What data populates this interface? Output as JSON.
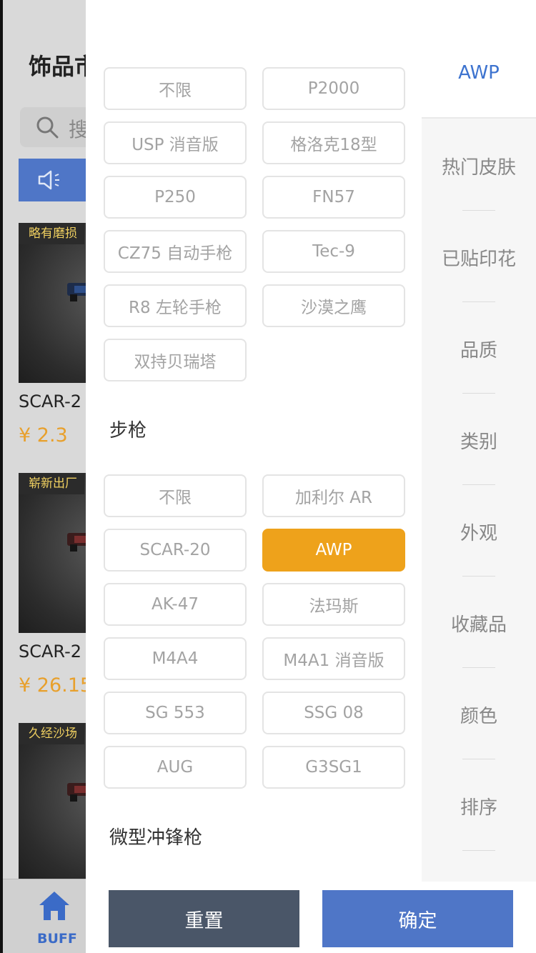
{
  "background": {
    "title": "饰品市",
    "search_placeholder": "搜",
    "cards": [
      {
        "tag": "略有磨损",
        "tag_color": "#3a5bd9",
        "name": "SCAR-2",
        "price": "¥ 2.3"
      },
      {
        "tag": "崭新出厂",
        "tag_color": "#b43fc9",
        "name": "SCAR-2",
        "price": "¥ 26.15"
      },
      {
        "tag": "久经沙场",
        "tag_color": "#b43fc9"
      }
    ],
    "tabbar": {
      "home_label": "BUFF"
    }
  },
  "drawer": {
    "pistol_options": [
      "不限",
      "P2000",
      "USP 消音版",
      "格洛克18型",
      "P250",
      "FN57",
      "CZ75 自动手枪",
      "Tec-9",
      "R8 左轮手枪",
      "沙漠之鹰",
      "双持贝瑞塔"
    ],
    "rifle_section_title": "步枪",
    "rifle_options": [
      "不限",
      "加利尔 AR",
      "SCAR-20",
      "AWP",
      "AK-47",
      "法玛斯",
      "M4A4",
      "M4A1 消音版",
      "SG 553",
      "SSG 08",
      "AUG",
      "G3SG1"
    ],
    "rifle_selected": "AWP",
    "smg_section_title": "微型冲锋枪",
    "nav": {
      "active": "AWP",
      "items": [
        "热门皮肤",
        "已贴印花",
        "品质",
        "类别",
        "外观",
        "收藏品",
        "颜色",
        "排序"
      ]
    },
    "footer": {
      "reset_label": "重置",
      "confirm_label": "确定"
    }
  },
  "colors": {
    "accent": "#eea21b",
    "nav_active": "#3d73cf",
    "confirm": "#4f76c7",
    "reset": "#4a5668"
  }
}
